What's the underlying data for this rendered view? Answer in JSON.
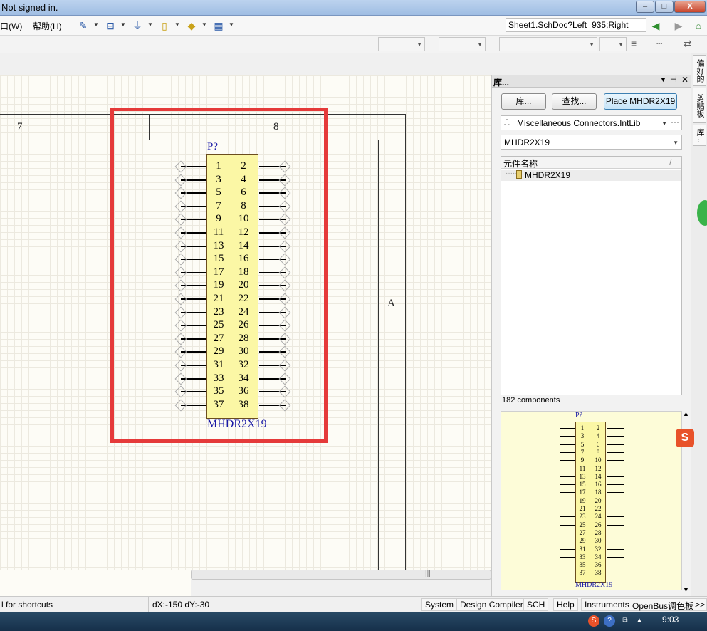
{
  "titlebar": {
    "status_text": "Not signed in.",
    "min_label": "–",
    "max_label": "□",
    "close_label": "X"
  },
  "menu": {
    "window_label": "口(W)",
    "help_label": "帮助(H)"
  },
  "address": {
    "value": "Sheet1.SchDoc?Left=935;Right="
  },
  "sheet": {
    "zone_7": "7",
    "zone_8": "8",
    "zone_a": "A"
  },
  "component": {
    "designator": "P?",
    "name": "MHDR2X19",
    "pins_left": [
      "1",
      "3",
      "5",
      "7",
      "9",
      "11",
      "13",
      "15",
      "17",
      "19",
      "21",
      "23",
      "25",
      "27",
      "29",
      "31",
      "33",
      "35",
      "37"
    ],
    "pins_right": [
      "2",
      "4",
      "6",
      "8",
      "10",
      "12",
      "14",
      "16",
      "18",
      "20",
      "22",
      "24",
      "26",
      "28",
      "30",
      "32",
      "34",
      "36",
      "38"
    ]
  },
  "panel": {
    "title": "库...",
    "btn_libraries": "库...",
    "btn_search": "查找...",
    "btn_place": "Place MHDR2X19",
    "library": "Miscellaneous Connectors.IntLib",
    "filter": "MHDR2X19",
    "column_header": "元件名称",
    "sort_glyph": "/",
    "item": "MHDR2X19",
    "count": "182 components",
    "preview_designator": "P?",
    "preview_name": "MHDR2X19"
  },
  "side_tabs": [
    "偏好的",
    "剪贴板",
    "库..."
  ],
  "status": {
    "left_text": "l for shortcuts",
    "delta": "dX:-150 dY:-30",
    "buttons": [
      "System",
      "Design Compiler",
      "SCH",
      "Help",
      "Instruments",
      "OpenBus调色板"
    ],
    "more": ">>"
  },
  "taskbar": {
    "time": "9:03"
  },
  "colors": {
    "highlight_box": "#e53a3a",
    "component_fill": "#fbf7a5",
    "label_blue": "#1a1aa6"
  }
}
